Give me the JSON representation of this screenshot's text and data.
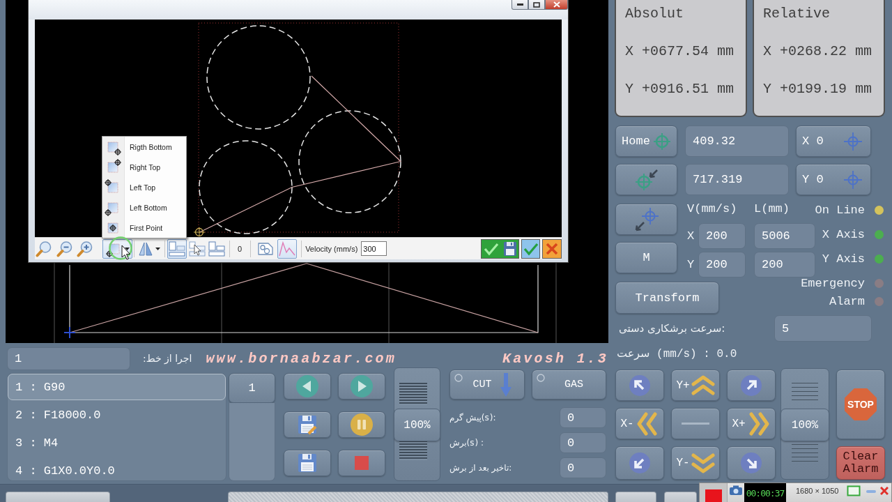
{
  "dialog": {
    "origin_menu": [
      {
        "label": "Rigth Bottom",
        "kind": "southeast"
      },
      {
        "label": "Right Top",
        "kind": "northeast"
      },
      {
        "label": "Left Top",
        "kind": "northwest"
      },
      {
        "label": "Left Bottom",
        "kind": "southwest"
      },
      {
        "label": "First Point",
        "kind": "center"
      }
    ],
    "toolbar": {
      "tools": [
        {
          "kind": "fit"
        },
        {
          "kind": "zoomout"
        },
        {
          "kind": "zoomin"
        },
        {
          "kind": "origin",
          "expanded": true
        },
        {
          "kind": "mirror"
        },
        {
          "kind": "stack",
          "pressed": true
        },
        {
          "kind": "pick",
          "pressed": false
        },
        {
          "kind": "split",
          "pressed": false
        }
      ],
      "counter": "0",
      "views": [
        {
          "kind": "shape",
          "pressed": false
        },
        {
          "kind": "graph",
          "pressed": true
        }
      ],
      "velocity": {
        "label": "Velocity (mm/s)",
        "value": "300"
      },
      "actions": [
        {
          "kind": "savecheck"
        },
        {
          "kind": "check"
        },
        {
          "kind": "cancel"
        }
      ]
    }
  },
  "readouts": [
    {
      "title": "Absolut",
      "x": "X +0677.54 mm",
      "y": "Y +0916.51 mm"
    },
    {
      "title": "Relative",
      "x": "X +0268.22 mm",
      "y": "Y +0199.19 mm"
    }
  ],
  "positions": [
    {
      "kind": "home",
      "button": "Home",
      "value": "409.32",
      "zero": "X 0"
    },
    {
      "kind": "park",
      "value": "717.319",
      "zero": "Y 0"
    }
  ],
  "side_buttons": [
    {
      "kind": "origin"
    },
    {
      "kind": "mode",
      "label": "M"
    }
  ],
  "feed_table": {
    "headers": [
      "V(mm/s)",
      "L(mm)"
    ],
    "rows": [
      {
        "axis": "X",
        "speed": "200",
        "length": "5006"
      },
      {
        "axis": "Y",
        "speed": "200",
        "length": "200"
      }
    ]
  },
  "transform_button": "Transform",
  "indicators": [
    {
      "label": "On Line",
      "color": "#d4c35c"
    },
    {
      "label": "X Axis",
      "color": "#4cae4f"
    },
    {
      "label": "Y Axis",
      "color": "#4cae4f"
    },
    {
      "label": "Emergency",
      "color": "#8a7d84"
    },
    {
      "label": "Alarm",
      "color": "#8a7d84"
    }
  ],
  "manual_speed": {
    "label": "سرعت برشکاری دستی:",
    "value": "5"
  },
  "speed_readout": "سرعت (mm/s) : 0.0",
  "jog": {
    "buttons": [
      {
        "kind": "upleft"
      },
      {
        "kind": "up",
        "label": "Y+"
      },
      {
        "kind": "upright"
      },
      {
        "kind": "left",
        "label": "X-"
      },
      {
        "kind": "hold"
      },
      {
        "kind": "right",
        "label": "X+"
      },
      {
        "kind": "downleft"
      },
      {
        "kind": "down",
        "label": "Y-"
      },
      {
        "kind": "downright"
      }
    ],
    "override": {
      "label": "100%",
      "level": 0.5
    }
  },
  "stop_button": "STOP",
  "clear_alarm_button": "Clear Alarm",
  "program": {
    "start_line": {
      "value": "1",
      "label": "اجرا از خط:"
    },
    "website": "www.bornaabzar.com",
    "version": "Kavosh 1.3",
    "lines": [
      {
        "text": "1 : G90",
        "selected": true
      },
      {
        "text": "2 : F18000.0",
        "selected": false
      },
      {
        "text": "3 : M4",
        "selected": false
      },
      {
        "text": "4 : G1X0.0Y0.0",
        "selected": false
      }
    ],
    "line_button": "1"
  },
  "run_controls": {
    "buttons": [
      {
        "kind": "previous"
      },
      {
        "kind": "next"
      },
      {
        "kind": "saveas"
      },
      {
        "kind": "pause"
      },
      {
        "kind": "save"
      },
      {
        "kind": "stop"
      }
    ],
    "override": {
      "label": "100%",
      "level": 0.5
    }
  },
  "torch": {
    "toggles": [
      {
        "kind": "cut",
        "label": "CUT",
        "on": false
      },
      {
        "kind": "gas",
        "label": "GAS",
        "on": false
      }
    ],
    "timings": [
      {
        "label": "پیش گرم(s):",
        "value": "0"
      },
      {
        "label": "برش(s) :",
        "value": "0"
      },
      {
        "label": "تاخیر بعد از برش:",
        "value": "0"
      }
    ]
  },
  "recorder": {
    "timer": "00:00:37",
    "resolution": "1680 × 1050"
  }
}
